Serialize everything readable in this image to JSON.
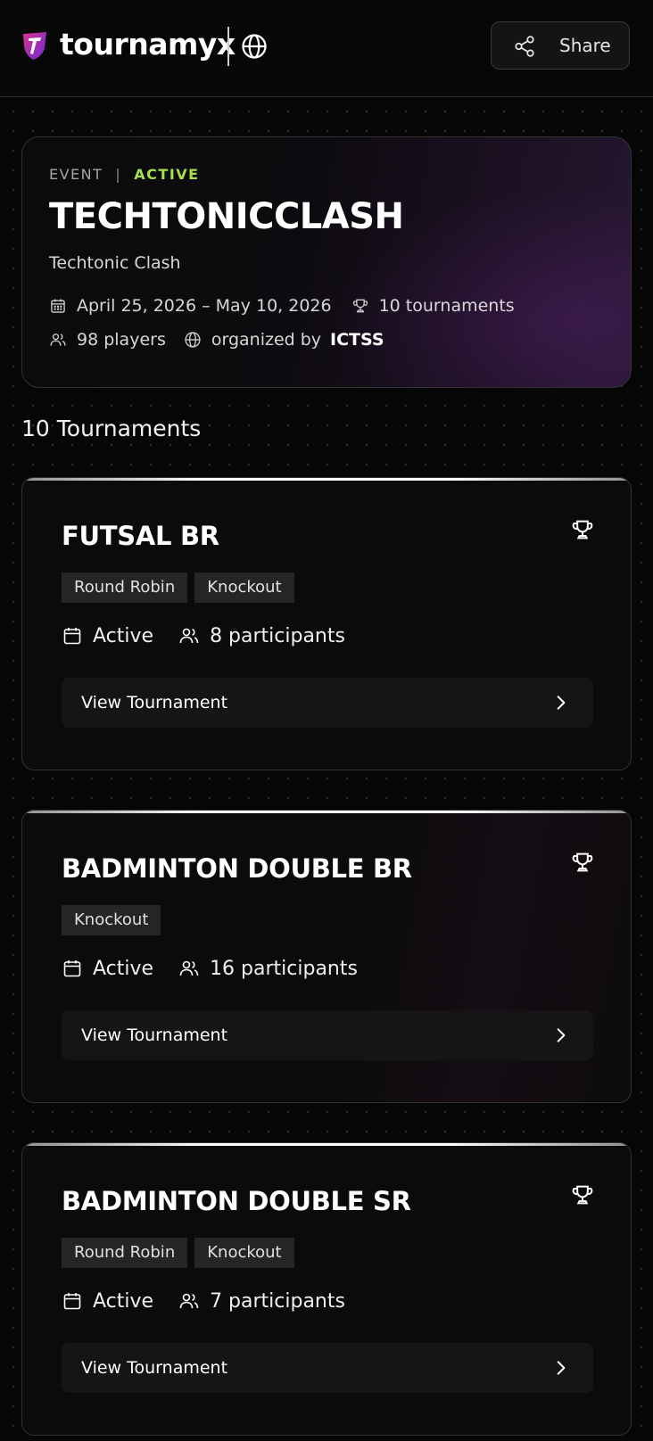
{
  "header": {
    "brand": "tournamyx",
    "share_label": "Share",
    "icons": [
      "logo-mark",
      "globe-icon",
      "share-icon"
    ]
  },
  "event": {
    "type_label": "EVENT",
    "separator": "|",
    "status": "ACTIVE",
    "title": "TECHTONICCLASH",
    "subtitle": "Techtonic Clash",
    "date_range": "April 25, 2026 – May 10, 2026",
    "tournaments_count": "10 tournaments",
    "players": "98 players",
    "organized_by_label": "organized by",
    "organizer": "ICTSS"
  },
  "section": {
    "heading": "10 Tournaments"
  },
  "tournaments": [
    {
      "name": "FUTSAL BR",
      "formats": [
        "Round Robin",
        "Knockout"
      ],
      "status": "Active",
      "participants": "8 participants",
      "cta": "View Tournament"
    },
    {
      "name": "BADMINTON DOUBLE BR",
      "formats": [
        "Knockout"
      ],
      "status": "Active",
      "participants": "16 participants",
      "cta": "View Tournament"
    },
    {
      "name": "BADMINTON DOUBLE SR",
      "formats": [
        "Round Robin",
        "Knockout"
      ],
      "status": "Active",
      "participants": "7 participants",
      "cta": "View Tournament"
    }
  ],
  "colors": {
    "background": "#060606",
    "accent_active": "#a6e14a",
    "logo_pink": "#e0338f",
    "logo_violet": "#6a2bd6"
  }
}
